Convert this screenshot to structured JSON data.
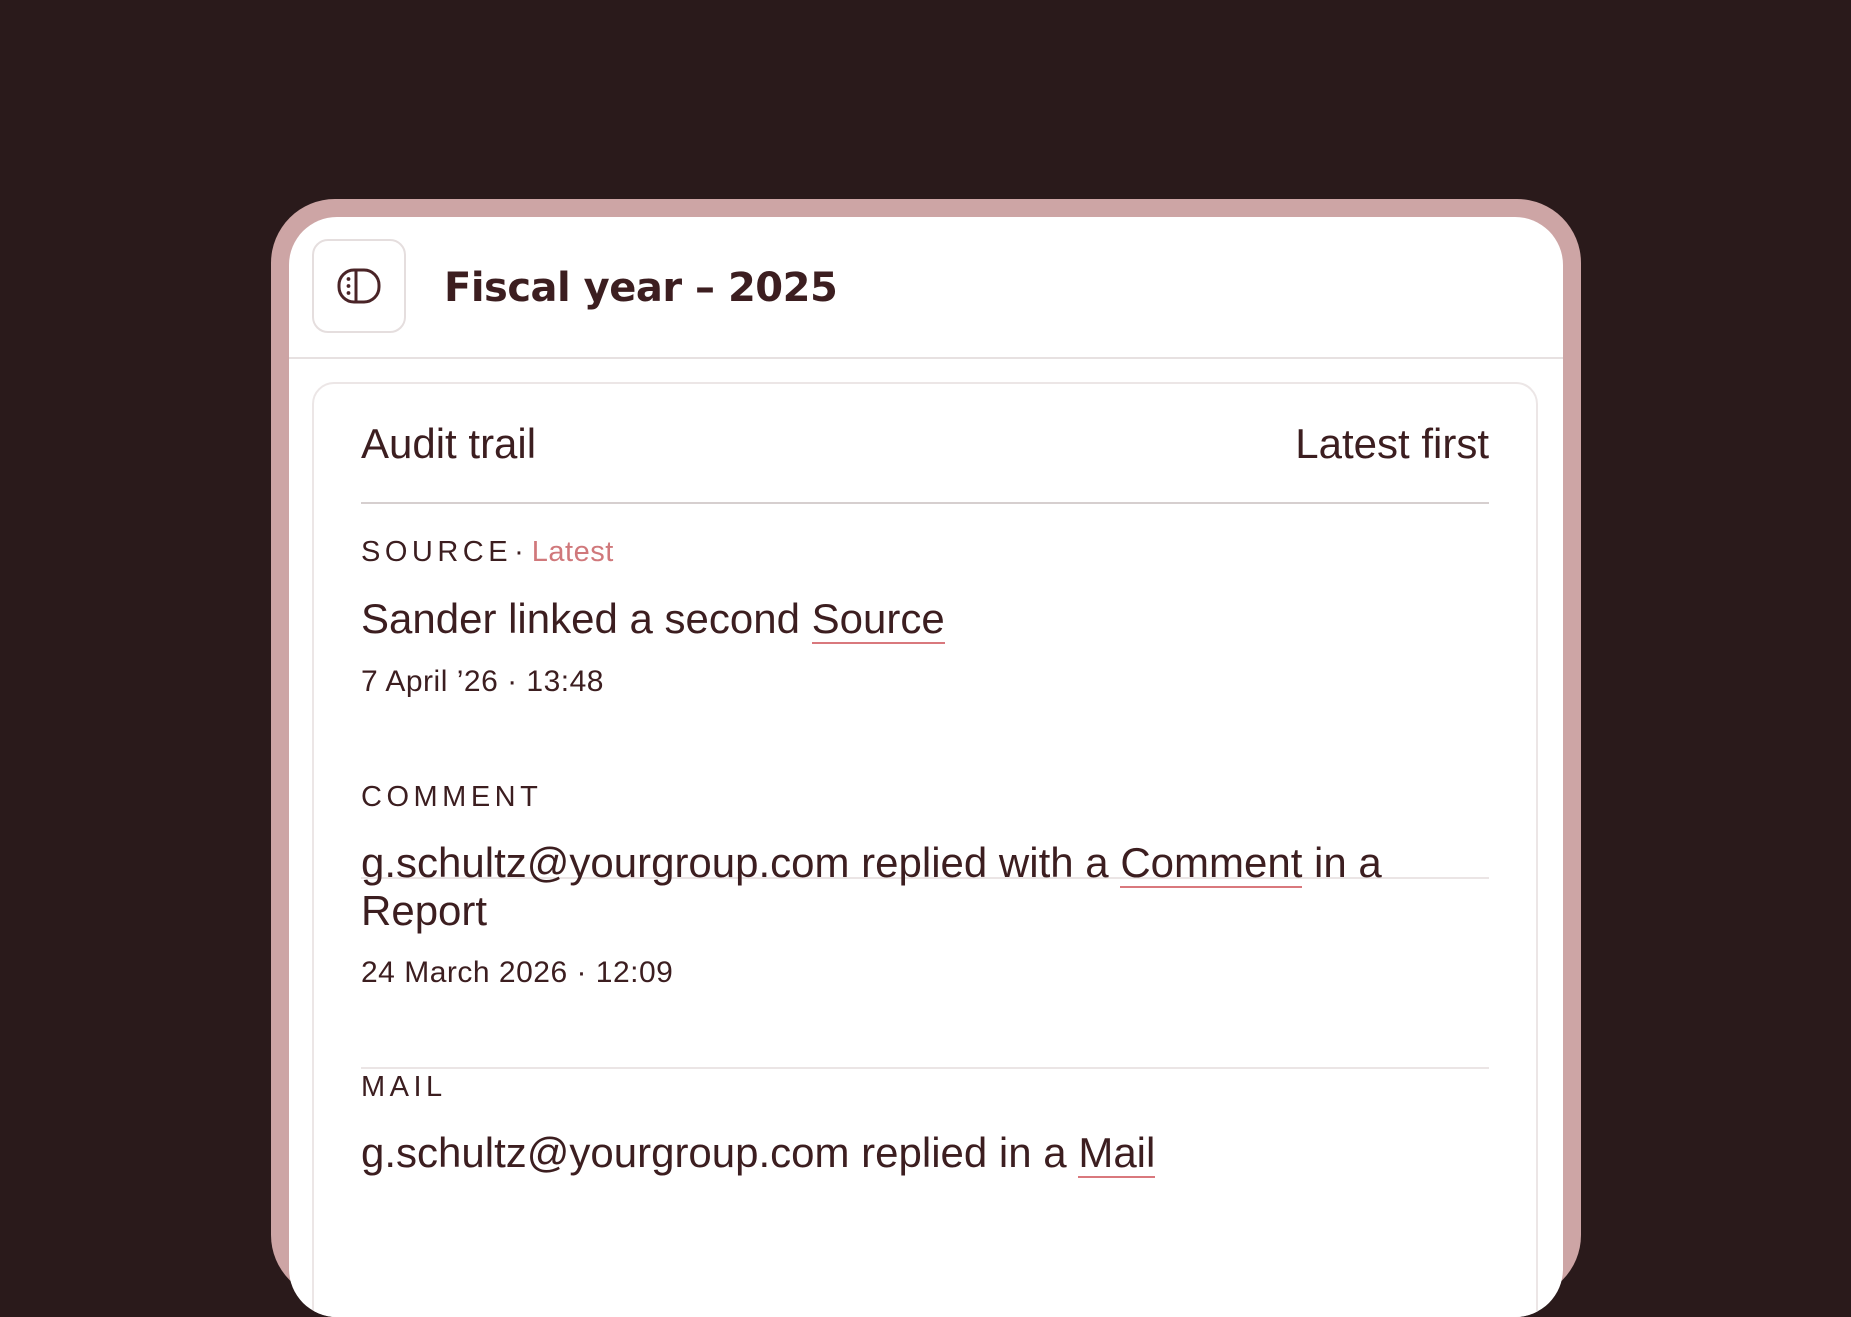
{
  "header": {
    "title": "Fiscal year – 2025",
    "toggle_icon": "sidebar-toggle-icon"
  },
  "panel": {
    "title": "Audit trail",
    "sort_label": "Latest first"
  },
  "entries": [
    {
      "type": "SOURCE",
      "separator": "·",
      "badge": "Latest",
      "text_before": "Sander linked a second ",
      "link": "Source",
      "text_after": "",
      "time": "7 April ’26 · 13:48"
    },
    {
      "type": "COMMENT",
      "text_before": "g.schultz@yourgroup.com replied with a ",
      "link": "Comment",
      "text_after": " in a Report",
      "time": "24 March 2026 · 12:09"
    },
    {
      "type": "MAIL",
      "text_before": "g.schultz@yourgroup.com replied in a ",
      "link": "Mail",
      "text_after": ""
    }
  ],
  "colors": {
    "background": "#2a1a1b",
    "frame": "#cda5a5",
    "text": "#3c1e20",
    "accent": "#d0787b"
  }
}
